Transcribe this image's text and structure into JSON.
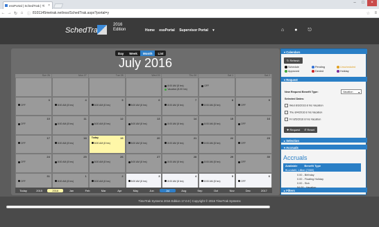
{
  "browser": {
    "tab_title": "essPortal | SchedTrak | Ti",
    "url": "8101145metrak.net/ess/SchedTrak.aspx?portal=y"
  },
  "app": {
    "brand": "SchedTrak",
    "edition_year": "2016",
    "edition_label": "Edition",
    "nav": [
      "Home",
      "essPortal",
      "Supervisor Portal"
    ],
    "supervisor_caret": "▾"
  },
  "calendar": {
    "views": [
      "Day",
      "Week",
      "Month",
      "List"
    ],
    "active_view": "Month",
    "title": "July 2016",
    "day_headers": [
      "Sun 26",
      "Mon 27",
      "Tue 28",
      "Wed 29",
      "Thu 30",
      "Sat 1",
      "Sat 2"
    ],
    "weeks": [
      {
        "days": [
          {
            "n": "",
            "ev": "",
            "style": "normal"
          },
          {
            "n": "",
            "ev": "",
            "style": "normal"
          },
          {
            "n": "",
            "ev": "",
            "style": "normal"
          },
          {
            "n": "",
            "ev": "",
            "style": "normal"
          },
          {
            "n": "",
            "ev": "8:00 AM (8 hrs)",
            "ev2": "Vacation (8.00 hrs)",
            "style": "normal"
          },
          {
            "n": "",
            "ev": "OFF",
            "style": "normal"
          },
          {
            "n": "",
            "ev": "",
            "style": "normal"
          }
        ]
      },
      {
        "days": [
          {
            "n": "3",
            "ev": "OFF"
          },
          {
            "n": "4",
            "ev": "8:00 AM (8 hrs)"
          },
          {
            "n": "5",
            "ev": "8:00 AM (8 hrs)"
          },
          {
            "n": "6",
            "ev": "8:00 AM (8 hrs)"
          },
          {
            "n": "7",
            "ev": "8:00 AM (8 hrs)"
          },
          {
            "n": "8",
            "ev": "8:00 AM (8 hrs)"
          },
          {
            "n": "9",
            "ev": "OFF"
          }
        ]
      },
      {
        "days": [
          {
            "n": "10",
            "ev": "OFF"
          },
          {
            "n": "11",
            "ev": "8:00 AM (8 hrs)"
          },
          {
            "n": "12",
            "ev": "8:00 AM (8 hrs)"
          },
          {
            "n": "13",
            "ev": "8:00 AM (8 hrs)"
          },
          {
            "n": "14",
            "ev": "8:00 AM (8 hrs)"
          },
          {
            "n": "15",
            "ev": "8:00 AM (8 hrs)"
          },
          {
            "n": "16",
            "ev": "OFF"
          }
        ]
      },
      {
        "days": [
          {
            "n": "17",
            "ev": "OFF"
          },
          {
            "n": "18",
            "ev": "8:00 AM (8 hrs)"
          },
          {
            "n": "19",
            "ev": "8:00 AM (8 hrs)",
            "style": "today",
            "today": "Today"
          },
          {
            "n": "20",
            "ev": "8:00 AM (8 hrs)"
          },
          {
            "n": "21",
            "ev": "8:00 AM (8 hrs)"
          },
          {
            "n": "22",
            "ev": "8:00 AM (8 hrs)"
          },
          {
            "n": "23",
            "ev": "OFF"
          }
        ]
      },
      {
        "days": [
          {
            "n": "24",
            "ev": "OFF"
          },
          {
            "n": "25",
            "ev": "8:00 AM (8 hrs)"
          },
          {
            "n": "26",
            "ev": "8:00 AM (8 hrs)"
          },
          {
            "n": "27",
            "ev": "8:00 AM (8 hrs)"
          },
          {
            "n": "28",
            "ev": "8:00 AM (8 hrs)"
          },
          {
            "n": "29",
            "ev": "8:00 AM (8 hrs)"
          },
          {
            "n": "30",
            "ev": "OFF"
          }
        ]
      },
      {
        "days": [
          {
            "n": "31",
            "ev": "OFF"
          },
          {
            "n": "1",
            "ev": "8:00 AM (8 hrs)"
          },
          {
            "n": "2",
            "ev": "8:00 AM (8 hrs)"
          },
          {
            "n": "3",
            "ev": "8:00 AM (8 hrs)",
            "style": "white"
          },
          {
            "n": "4",
            "ev": "8:00 AM (8 hrs)",
            "style": "white"
          },
          {
            "n": "5",
            "ev": "8:00 AM (8 hrs)",
            "style": "white"
          },
          {
            "n": "6",
            "ev": "OFF",
            "style": "white"
          }
        ]
      }
    ],
    "timeline": [
      "2015",
      "2016",
      "Jan",
      "Feb",
      "Mar",
      "Apr",
      "May",
      "Jun",
      "Jul",
      "Aug",
      "Sep",
      "Oct",
      "Nov",
      "Dec",
      "2017"
    ],
    "timeline_active": "Jul",
    "timeline_year_active": "2016",
    "timeline_today": "Today"
  },
  "sidebar": {
    "calendars_title": "Calendars",
    "refresh": "Refresh",
    "legend": [
      {
        "label": "Schedule",
        "color": "#111111"
      },
      {
        "label": "Pending",
        "color": "#2f6fd6"
      },
      {
        "label": "Unscheduled",
        "color": "#e0a020"
      },
      {
        "label": "Approved",
        "color": "#3ca83c"
      },
      {
        "label": "Denied",
        "color": "#cc2222"
      },
      {
        "label": "Holiday",
        "color": "#7a2f9a"
      }
    ],
    "request_title": "Request",
    "new_request_label": "New Request Benefit Type:",
    "benefit_value": "Vacation",
    "selected_dates_label": "Selected Dates:",
    "selected_dates": [
      "Wed 8/3/2016 8 hrs Vacation",
      "Thu 8/4/2016 8 hrs Vacation",
      "Fri 8/5/2016 8 hrs Vacation"
    ],
    "request_btn": "Request",
    "reset_btn": "Reset",
    "selection_title": "Selection",
    "accruals_title": "Accruals",
    "accruals_header": [
      "Available",
      "Benefit Type"
    ],
    "accruals_group": "Lundahl, Lillian (7880)",
    "accruals_rows": [
      "0.00 - Birthday",
      "0.00 - Floating Holiday",
      "0.00 - Sick",
      "54.00 - Vacation"
    ],
    "filters_title": "Filters"
  },
  "footer": "TimeTrak Systems 2016 Edition 17.0.0  |  Copyright © 2016 TimeTrak Systems"
}
